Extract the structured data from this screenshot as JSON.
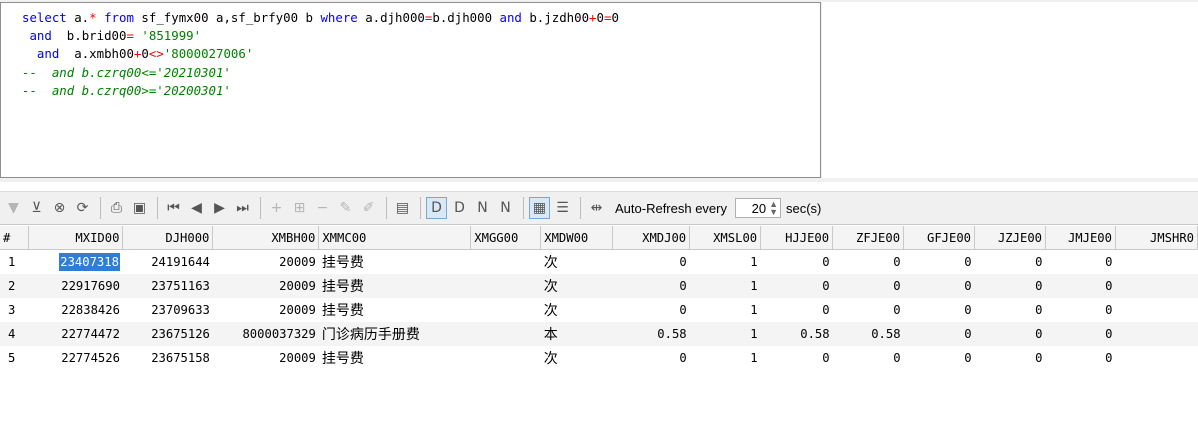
{
  "editor": {
    "lines": [
      [
        {
          "t": "select",
          "c": "kw"
        },
        {
          "t": " a.",
          "c": ""
        },
        {
          "t": "*",
          "c": "op"
        },
        {
          "t": " ",
          "c": ""
        },
        {
          "t": "from",
          "c": "kw"
        },
        {
          "t": " sf_fymx00 a,sf_brfy00 b ",
          "c": ""
        },
        {
          "t": "where",
          "c": "kw"
        },
        {
          "t": " a.djh000",
          "c": ""
        },
        {
          "t": "=",
          "c": "op"
        },
        {
          "t": "b.djh000 ",
          "c": ""
        },
        {
          "t": "and",
          "c": "kw"
        },
        {
          "t": " b.jzdh00",
          "c": ""
        },
        {
          "t": "+",
          "c": "op"
        },
        {
          "t": "0",
          "c": ""
        },
        {
          "t": "=",
          "c": "op"
        },
        {
          "t": "0",
          "c": ""
        }
      ],
      [
        {
          "t": " ",
          "c": ""
        },
        {
          "t": "and",
          "c": "kw"
        },
        {
          "t": "  b.brid00",
          "c": ""
        },
        {
          "t": "=",
          "c": "op"
        },
        {
          "t": " ",
          "c": ""
        },
        {
          "t": "'851999'",
          "c": "str"
        }
      ],
      [
        {
          "t": "  ",
          "c": ""
        },
        {
          "t": "and",
          "c": "kw"
        },
        {
          "t": "  a.xmbh00",
          "c": ""
        },
        {
          "t": "+",
          "c": "op"
        },
        {
          "t": "0",
          "c": ""
        },
        {
          "t": "<>",
          "c": "op"
        },
        {
          "t": "'8000027006'",
          "c": "str"
        }
      ],
      [
        {
          "t": "--  and b.czrq00<='20210301'",
          "c": "cm"
        }
      ],
      [
        {
          "t": "--  and b.czrq00>='20200301'",
          "c": "cm"
        }
      ]
    ]
  },
  "toolbar": {
    "icons": [
      {
        "name": "filter-dropdown-icon",
        "g": "▼",
        "dis": true
      },
      {
        "name": "filter-icon",
        "g": "⊻",
        "dis": false
      },
      {
        "name": "clear-filter-icon",
        "g": "⊗",
        "dis": false
      },
      {
        "name": "refresh-icon",
        "g": "⟳",
        "dis": false
      },
      {
        "sep": true
      },
      {
        "name": "print-icon",
        "g": "⎙",
        "dis": false
      },
      {
        "name": "save-icon",
        "g": "▣",
        "dis": false
      },
      {
        "sep": true
      },
      {
        "name": "first-record-icon",
        "g": "⏮",
        "dis": false
      },
      {
        "name": "prev-record-icon",
        "g": "◀",
        "dis": false
      },
      {
        "name": "next-record-icon",
        "g": "▶",
        "dis": false
      },
      {
        "name": "last-record-icon",
        "g": "⏭",
        "dis": false
      },
      {
        "sep": true
      },
      {
        "name": "add-record-icon",
        "g": "+",
        "dis": true
      },
      {
        "name": "insert-record-icon",
        "g": "⊞",
        "dis": true
      },
      {
        "name": "delete-record-icon",
        "g": "−",
        "dis": true
      },
      {
        "name": "edit-record-icon",
        "g": "✎",
        "dis": true
      },
      {
        "name": "cancel-edit-icon",
        "g": "✐",
        "dis": true
      },
      {
        "sep": true
      },
      {
        "name": "memo-icon",
        "g": "▤",
        "dis": false
      },
      {
        "sep": true
      },
      {
        "name": "set-default-icon",
        "g": "D",
        "dis": false,
        "active": true
      },
      {
        "name": "set-d-icon",
        "g": "D",
        "dis": false
      },
      {
        "name": "set-null-icon",
        "g": "N",
        "dis": false
      },
      {
        "name": "set-nd-icon",
        "g": "N",
        "dis": false
      },
      {
        "sep": true
      },
      {
        "name": "grid-view-icon",
        "g": "▦",
        "dis": false,
        "active": true
      },
      {
        "name": "form-view-icon",
        "g": "☰",
        "dis": false
      },
      {
        "sep": true
      },
      {
        "name": "fit-columns-icon",
        "g": "⇹",
        "dis": false
      }
    ],
    "refresh_label": "Auto-Refresh every",
    "refresh_value": "20",
    "refresh_unit": "sec(s)"
  },
  "grid": {
    "columns": [
      "#",
      "MXID00",
      "DJH000",
      "XMBH00",
      "XMMC00",
      "XMGG00",
      "XMDW00",
      "XMDJ00",
      "XMSL00",
      "HJJE00",
      "ZFJE00",
      "GFJE00",
      "JZJE00",
      "JMJE00",
      "JMSHR0"
    ],
    "rows": [
      [
        "1",
        "23407318",
        "24191644",
        "20009",
        "挂号费",
        "",
        "次",
        "0",
        "1",
        "0",
        "0",
        "0",
        "0",
        "0",
        ""
      ],
      [
        "2",
        "22917690",
        "23751163",
        "20009",
        "挂号费",
        "",
        "次",
        "0",
        "1",
        "0",
        "0",
        "0",
        "0",
        "0",
        ""
      ],
      [
        "3",
        "22838426",
        "23709633",
        "20009",
        "挂号费",
        "",
        "次",
        "0",
        "1",
        "0",
        "0",
        "0",
        "0",
        "0",
        ""
      ],
      [
        "4",
        "22774472",
        "23675126",
        "8000037329",
        "门诊病历手册费",
        "",
        "本",
        "0.58",
        "1",
        "0.58",
        "0.58",
        "0",
        "0",
        "0",
        ""
      ],
      [
        "5",
        "22774526",
        "23675158",
        "20009",
        "挂号费",
        "",
        "次",
        "0",
        "1",
        "0",
        "0",
        "0",
        "0",
        "0",
        ""
      ]
    ]
  }
}
